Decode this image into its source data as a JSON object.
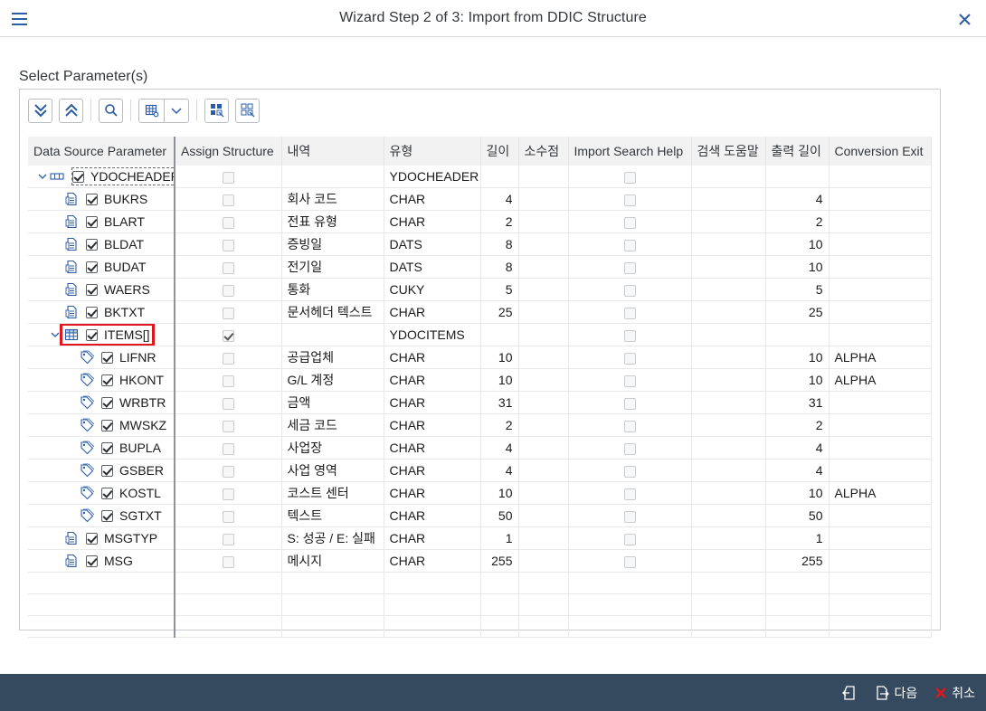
{
  "window": {
    "title": "Wizard Step 2 of 3: Import from DDIC Structure"
  },
  "section": {
    "label": "Select Parameter(s)"
  },
  "columns": [
    "Data Source Parameter",
    "Assign Structure",
    "내역",
    "유형",
    "길이",
    "소수점",
    "Import Search Help",
    "검색 도움말",
    "출력 길이",
    "Conversion Exit"
  ],
  "rows": [
    {
      "name": "YDOCHEADER",
      "level": 0,
      "kind": "structure",
      "expand": true,
      "assign": false,
      "desc": "",
      "type": "YDOCHEADER",
      "len": "",
      "dec": "",
      "search": true,
      "help": "",
      "outlen": "",
      "conv": ""
    },
    {
      "name": "BUKRS",
      "level": 1,
      "kind": "field",
      "assign": false,
      "desc": "회사 코드",
      "type": "CHAR",
      "len": "4",
      "dec": "",
      "search": true,
      "help": "",
      "outlen": "4",
      "conv": ""
    },
    {
      "name": "BLART",
      "level": 1,
      "kind": "field",
      "assign": false,
      "desc": "전표 유형",
      "type": "CHAR",
      "len": "2",
      "dec": "",
      "search": true,
      "help": "",
      "outlen": "2",
      "conv": ""
    },
    {
      "name": "BLDAT",
      "level": 1,
      "kind": "field",
      "assign": false,
      "desc": "증빙일",
      "type": "DATS",
      "len": "8",
      "dec": "",
      "search": true,
      "help": "",
      "outlen": "10",
      "conv": ""
    },
    {
      "name": "BUDAT",
      "level": 1,
      "kind": "field",
      "assign": false,
      "desc": "전기일",
      "type": "DATS",
      "len": "8",
      "dec": "",
      "search": true,
      "help": "",
      "outlen": "10",
      "conv": ""
    },
    {
      "name": "WAERS",
      "level": 1,
      "kind": "field",
      "assign": false,
      "desc": "통화",
      "type": "CUKY",
      "len": "5",
      "dec": "",
      "search": true,
      "help": "",
      "outlen": "5",
      "conv": ""
    },
    {
      "name": "BKTXT",
      "level": 1,
      "kind": "field",
      "assign": false,
      "desc": "문서헤더 텍스트",
      "type": "CHAR",
      "len": "25",
      "dec": "",
      "search": true,
      "help": "",
      "outlen": "25",
      "conv": ""
    },
    {
      "name": "ITEMS[]",
      "level": 1,
      "kind": "table",
      "expand": true,
      "highlight": true,
      "assign": true,
      "desc": "",
      "type": "YDOCITEMS",
      "len": "",
      "dec": "",
      "search": true,
      "help": "",
      "outlen": "",
      "conv": ""
    },
    {
      "name": "LIFNR",
      "level": 2,
      "kind": "tag",
      "assign": false,
      "desc": "공급업체",
      "type": "CHAR",
      "len": "10",
      "dec": "",
      "search": true,
      "help": "",
      "outlen": "10",
      "conv": "ALPHA"
    },
    {
      "name": "HKONT",
      "level": 2,
      "kind": "tag",
      "assign": false,
      "desc": "G/L 계정",
      "type": "CHAR",
      "len": "10",
      "dec": "",
      "search": true,
      "help": "",
      "outlen": "10",
      "conv": "ALPHA"
    },
    {
      "name": "WRBTR",
      "level": 2,
      "kind": "tag",
      "assign": false,
      "desc": "금액",
      "type": "CHAR",
      "len": "31",
      "dec": "",
      "search": true,
      "help": "",
      "outlen": "31",
      "conv": ""
    },
    {
      "name": "MWSKZ",
      "level": 2,
      "kind": "tag",
      "assign": false,
      "desc": "세금 코드",
      "type": "CHAR",
      "len": "2",
      "dec": "",
      "search": true,
      "help": "",
      "outlen": "2",
      "conv": ""
    },
    {
      "name": "BUPLA",
      "level": 2,
      "kind": "tag",
      "assign": false,
      "desc": "사업장",
      "type": "CHAR",
      "len": "4",
      "dec": "",
      "search": true,
      "help": "",
      "outlen": "4",
      "conv": ""
    },
    {
      "name": "GSBER",
      "level": 2,
      "kind": "tag",
      "assign": false,
      "desc": "사업 영역",
      "type": "CHAR",
      "len": "4",
      "dec": "",
      "search": true,
      "help": "",
      "outlen": "4",
      "conv": ""
    },
    {
      "name": "KOSTL",
      "level": 2,
      "kind": "tag",
      "assign": false,
      "desc": "코스트 센터",
      "type": "CHAR",
      "len": "10",
      "dec": "",
      "search": true,
      "help": "",
      "outlen": "10",
      "conv": "ALPHA"
    },
    {
      "name": "SGTXT",
      "level": 2,
      "kind": "tag",
      "assign": false,
      "desc": "텍스트",
      "type": "CHAR",
      "len": "50",
      "dec": "",
      "search": true,
      "help": "",
      "outlen": "50",
      "conv": ""
    },
    {
      "name": "MSGTYP",
      "level": 1,
      "kind": "field",
      "assign": false,
      "desc": "S: 성공 / E: 실패",
      "type": "CHAR",
      "len": "1",
      "dec": "",
      "search": true,
      "help": "",
      "outlen": "1",
      "conv": ""
    },
    {
      "name": "MSG",
      "level": 1,
      "kind": "field",
      "assign": false,
      "desc": "메시지",
      "type": "CHAR",
      "len": "255",
      "dec": "",
      "search": true,
      "help": "",
      "outlen": "255",
      "conv": ""
    }
  ],
  "footer": {
    "next_label": "다음",
    "cancel_label": "취소"
  },
  "colors": {
    "footer_bg": "#354a5f",
    "highlight": "#e0161e",
    "cancel_icon": "#e0161e"
  }
}
